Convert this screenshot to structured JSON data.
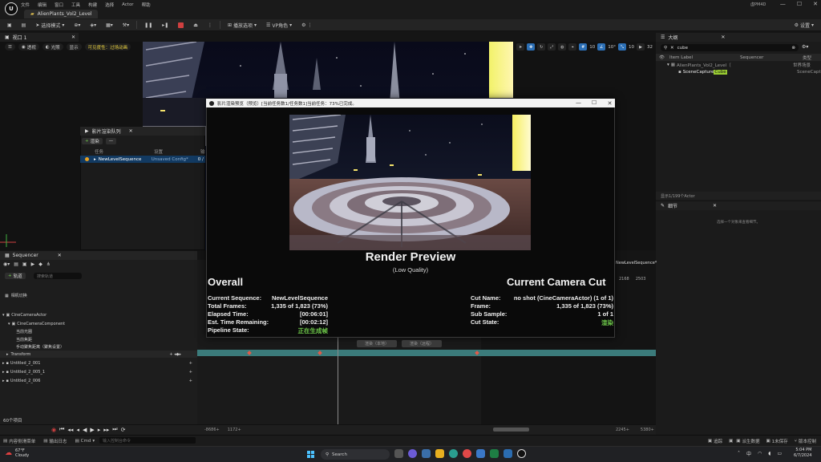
{
  "window": {
    "menu": [
      "文件",
      "编辑",
      "窗口",
      "工具",
      "构建",
      "选择",
      "Actor",
      "帮助"
    ],
    "level_tab": "AlienPlants_Vol2_Level",
    "project_name": "虚PM4D"
  },
  "toolbar": {
    "mode_label": "选择模式",
    "platform_label": "播放选项",
    "vp_label": "VP角色",
    "settings_label": "设置"
  },
  "viewport": {
    "tab_label": "视口 1",
    "perspective": "透视",
    "lit": "光照",
    "show": "显示",
    "scalability": "可见度性：过场动画",
    "grid_value": "10",
    "angle_value": "10°",
    "scale_value": "10",
    "speed_value": "32"
  },
  "outliner": {
    "tab_label": "大纲",
    "search_value": "cube",
    "col_label": "Item Label",
    "col_sequencer": "Sequencer",
    "col_type": "类型",
    "row1_label": "AlienPlants_Vol2_Level（",
    "row1_type": "世界场景",
    "row2_label": "SceneCapture",
    "row2_highlight": "Cube",
    "row2_type": "SceneCaptu",
    "footer": "显示1/199个Actor"
  },
  "details": {
    "tab_label": "细节",
    "empty_text": "选择一个对象来查看细节。"
  },
  "mrq": {
    "tab_label": "影片渲染队列",
    "add_label": "渲染",
    "remove_label": "—",
    "col_job": "任务",
    "col_settings": "设置",
    "col_output": "输",
    "job_name": "NewLevelSequence",
    "job_config": "Unsaved Config*",
    "job_output": "0 /"
  },
  "sequencer": {
    "tab_label": "Sequencer",
    "add_track": "轨道",
    "search_placeholder": "搜索轨道",
    "camera_cut": "相机切换",
    "actor": "CineCameraActor",
    "component": "CineCameraComponent",
    "prop1": "当前光圈",
    "prop2": "当前焦距",
    "prop3": "手动聚焦距离（聚焦设置）",
    "transform": "Transform",
    "items": [
      "Untitled_2_001",
      "Untitled_2_005_1",
      "Untitled_2_006"
    ],
    "item_count": "60个项目",
    "right_header": "NewLevelSequence*",
    "range_start": "-8686+",
    "range_in": "1172+",
    "range_out": "2245+",
    "range_end": "5380+",
    "tick_a": "2168",
    "tick_b": "2503"
  },
  "statusbar": {
    "content_drawer": "内容侧滑菜单",
    "output_log": "输出日志",
    "cmd": "Cmd",
    "cmd_placeholder": "输入控制台命令",
    "trace": "追踪",
    "derived": "派生数据",
    "unsaved": "1未保存",
    "source_control": "版本控制"
  },
  "dialog": {
    "title": "影片渲染预览（预览）[当前任务数1/任务数1]当前任务：73%已完成。",
    "render_title": "Render Preview",
    "quality": "(Low Quality)",
    "overall_title": "Overall",
    "camera_cut_title": "Current Camera Cut",
    "overall": [
      {
        "k": "Current Sequence:",
        "v": "NewLevelSequence"
      },
      {
        "k": "Total Frames:",
        "v": "1,335 of 1,823 (73%)"
      },
      {
        "k": "Elapsed Time:",
        "v": "[00:06:01]"
      },
      {
        "k": "Est. Time Remaining:",
        "v": "[00:02:12]"
      },
      {
        "k": "Pipeline State:",
        "v": "正在生成帧"
      }
    ],
    "camera_cut": [
      {
        "k": "Cut Name:",
        "v": "no shot (CineCameraActor) (1 of 1)"
      },
      {
        "k": "Frame:",
        "v": "1,335 of 1,823 (73%)"
      },
      {
        "k": "Sub Sample:",
        "v": "1 of 1"
      },
      {
        "k": "Cut State:",
        "v": "渲染"
      }
    ],
    "btn_a": "渲染（本地）",
    "btn_b": "渲染（远程）"
  },
  "taskbar": {
    "weather_temp": "67°F",
    "weather_desc": "Cloudy",
    "search": "Search",
    "time": "5:04 PM",
    "date": "6/7/2024"
  },
  "colors": {
    "accent": "#2c6fb5",
    "track": "#3b7b7b",
    "state_green": "#6ec94a",
    "highlight": "#9acd32"
  }
}
